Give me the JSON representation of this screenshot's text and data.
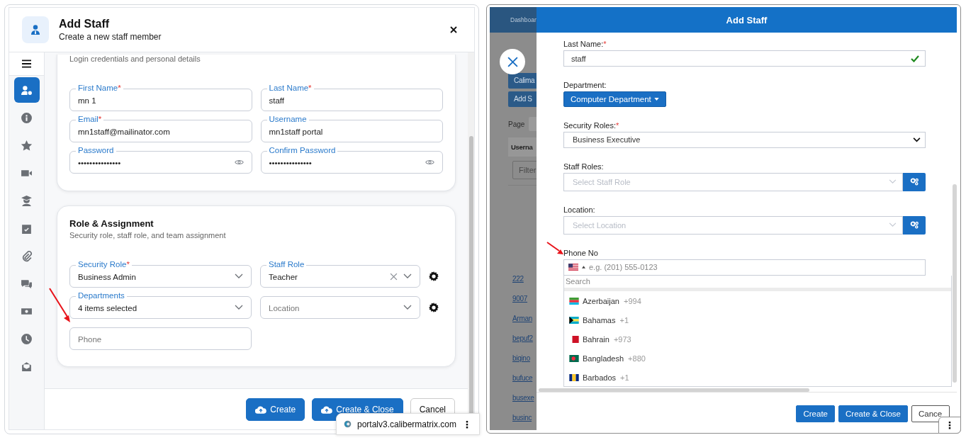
{
  "left": {
    "required_mark": "*",
    "header": {
      "title": "Add Staff",
      "subtitle": "Create a new staff member"
    },
    "sidebar": [
      {
        "selected": true
      },
      {
        "selected": false
      },
      {
        "selected": false
      },
      {
        "selected": false
      },
      {
        "selected": false
      },
      {
        "selected": false
      },
      {
        "selected": false
      },
      {
        "selected": false
      },
      {
        "selected": false
      },
      {
        "selected": false
      },
      {
        "selected": false
      }
    ],
    "personal": {
      "subtitle": "Login credentials and personal details",
      "fields": [
        {
          "label": "First Name",
          "required": true,
          "kind": "text",
          "value": "mn 1"
        },
        {
          "label": "Last Name",
          "required": true,
          "kind": "text",
          "value": "staff"
        },
        {
          "label": "Email",
          "required": true,
          "kind": "text",
          "value": "mn1staff@mailinator.com"
        },
        {
          "label": "Username",
          "required": false,
          "kind": "text",
          "value": "mn1staff portal"
        },
        {
          "label": "Password",
          "required": false,
          "kind": "password",
          "value": "•••••••••••••••"
        },
        {
          "label": "Confirm Password",
          "required": false,
          "kind": "password",
          "value": "•••••••••••••••"
        }
      ]
    },
    "role": {
      "title": "Role & Assignment",
      "subtitle": "Security role, staff role, and team assignment",
      "rows": [
        {
          "settings": true,
          "fields": [
            {
              "label": "Security Role",
              "required": true,
              "kind": "select",
              "value": "Business Admin",
              "clearable": false
            },
            {
              "label": "Staff Role",
              "required": false,
              "kind": "select",
              "value": "Teacher",
              "clearable": true
            }
          ]
        },
        {
          "settings": true,
          "fields": [
            {
              "label": "Departments",
              "required": false,
              "kind": "select",
              "value": "4 items selected",
              "clearable": false
            },
            {
              "kind": "select",
              "placeholder": "Location",
              "clearable": false
            }
          ]
        },
        {
          "settings": false,
          "fields": [
            {
              "kind": "text",
              "placeholder": "Phone"
            }
          ]
        }
      ]
    },
    "buttons": [
      {
        "label": "Create",
        "kind": "primary"
      },
      {
        "label": "Create & Close",
        "kind": "primary"
      },
      {
        "label": "Cancel",
        "kind": "secondary"
      }
    ],
    "popup": {
      "host": "portalv3.calibermatrix.com",
      "menu": "⋮"
    }
  },
  "right": {
    "page": {
      "nav": "Dashboar",
      "buttons": [
        "Calima",
        "Add S"
      ],
      "pager": "Page",
      "column": "Userna",
      "filter_placeholder": "Filter",
      "links": [
        "222",
        "9007",
        "Arman",
        "bepuf2",
        "biqino",
        "bufuce",
        "busexe",
        "businc"
      ]
    },
    "modal": {
      "title": "Add Staff",
      "required_mark": "*",
      "last_name": {
        "label": "Last Name:",
        "required": true,
        "value": "staff",
        "valid": true
      },
      "department": {
        "label": "Department:",
        "value": "Computer Department"
      },
      "security_roles": {
        "label": "Security Roles:",
        "required": true,
        "value": "Business Executive"
      },
      "staff_roles": {
        "label": "Staff Roles:",
        "required": false,
        "placeholder": "Select Staff Role"
      },
      "location": {
        "label": "Location:",
        "required": false,
        "placeholder": "Select Location"
      },
      "phone": {
        "label": "Phone No",
        "placeholder": "e.g. (201) 555-0123",
        "search_placeholder": "Search",
        "countries": [
          {
            "name": "Azerbaijan",
            "code": "+994"
          },
          {
            "name": "Bahamas",
            "code": "+1"
          },
          {
            "name": "Bahrain",
            "code": "+973"
          },
          {
            "name": "Bangladesh",
            "code": "+880"
          },
          {
            "name": "Barbados",
            "code": "+1"
          }
        ]
      },
      "buttons": [
        {
          "label": "Create",
          "kind": "primary"
        },
        {
          "label": "Create & Close",
          "kind": "primary"
        },
        {
          "label": "Cance",
          "kind": "secondary"
        }
      ]
    },
    "popup": {
      "menu": "⋮"
    }
  }
}
